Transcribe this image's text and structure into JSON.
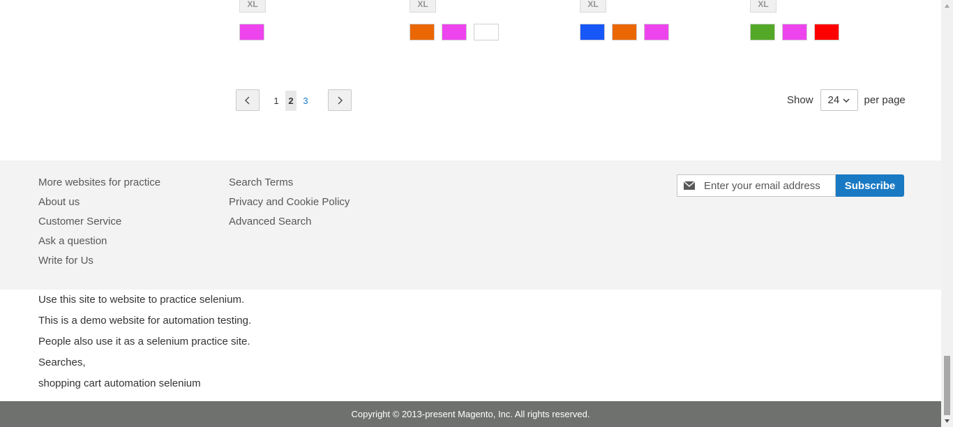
{
  "products": [
    {
      "size_label": "XL",
      "colors": [
        "#ee44ee"
      ]
    },
    {
      "size_label": "XL",
      "colors": [
        "#eb6703",
        "#ee44ee",
        "#ffffff"
      ]
    },
    {
      "size_label": "XL",
      "colors": [
        "#1857f7",
        "#eb6703",
        "#ee44ee"
      ]
    },
    {
      "size_label": "XL",
      "colors": [
        "#53a828",
        "#ee44ee",
        "#ff0000"
      ]
    }
  ],
  "pager": {
    "pages": [
      "1",
      "2",
      "3"
    ],
    "current_page": "2",
    "prev_icon": "chevron-left-icon",
    "next_icon": "chevron-right-icon"
  },
  "limiter": {
    "show_label": "Show",
    "value": "24",
    "per_page_label": "per page"
  },
  "footer": {
    "links_col1": [
      "More websites for practice",
      "About us",
      "Customer Service",
      "Ask a question",
      "Write for Us"
    ],
    "links_col2": [
      "Search Terms",
      "Privacy and Cookie Policy",
      "Advanced Search"
    ],
    "newsletter": {
      "placeholder": "Enter your email address",
      "button_label": "Subscribe",
      "icon": "envelope-icon"
    }
  },
  "info_lines": [
    "Use this site to website to practice selenium.",
    "This is a demo website for automation testing.",
    "People also use it as a selenium practice site.",
    "Searches,",
    "shopping cart automation selenium"
  ],
  "copyright": "Copyright © 2013-present Magento, Inc. All rights reserved.",
  "colors": {
    "accent": "#1979c3",
    "footer_bg": "#f3f3f3",
    "copyright_bg": "#6e716e"
  }
}
